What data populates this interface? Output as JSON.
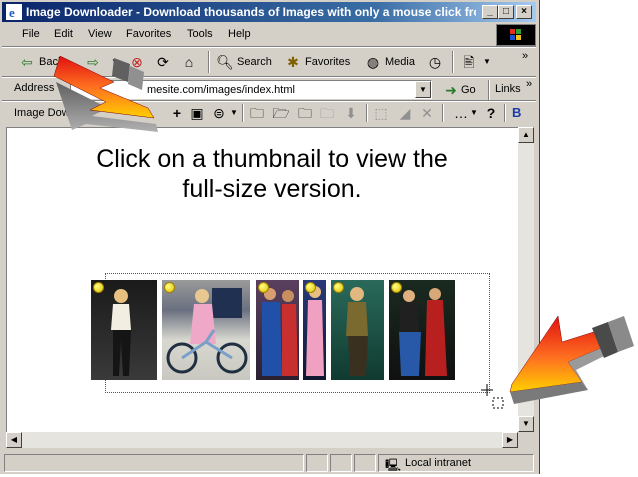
{
  "window": {
    "title": "Image Downloader - Download thousands of Images with only a mouse click fro...",
    "caption_buttons": [
      "_",
      "□",
      "×"
    ]
  },
  "menu": [
    "File",
    "Edit",
    "View",
    "Favorites",
    "Tools",
    "Help"
  ],
  "nav_toolbar": {
    "back_label": "Back",
    "search_label": "Search",
    "favorites_label": "Favorites",
    "media_label": "Media"
  },
  "address_bar": {
    "label": "Address",
    "url": "mesite.com/images/index.html",
    "go_label": "Go",
    "links_label": "Links"
  },
  "addon_toolbar": {
    "name": "Image Downloa",
    "b_label": "B"
  },
  "page": {
    "heading": "Click on a thumbnail to view the full-size version."
  },
  "thumbnails": [
    {
      "name": "thumbnail-1"
    },
    {
      "name": "thumbnail-2"
    },
    {
      "name": "thumbnail-3"
    },
    {
      "name": "thumbnail-4"
    },
    {
      "name": "thumbnail-5"
    },
    {
      "name": "thumbnail-6"
    }
  ],
  "status": {
    "zone": "Local intranet"
  },
  "colors": {
    "titlebar_start": "#0a246a",
    "titlebar_end": "#a6caf0",
    "chrome": "#d4d0c8",
    "arrow_red": "#e01010",
    "arrow_yellow": "#ffd000"
  }
}
